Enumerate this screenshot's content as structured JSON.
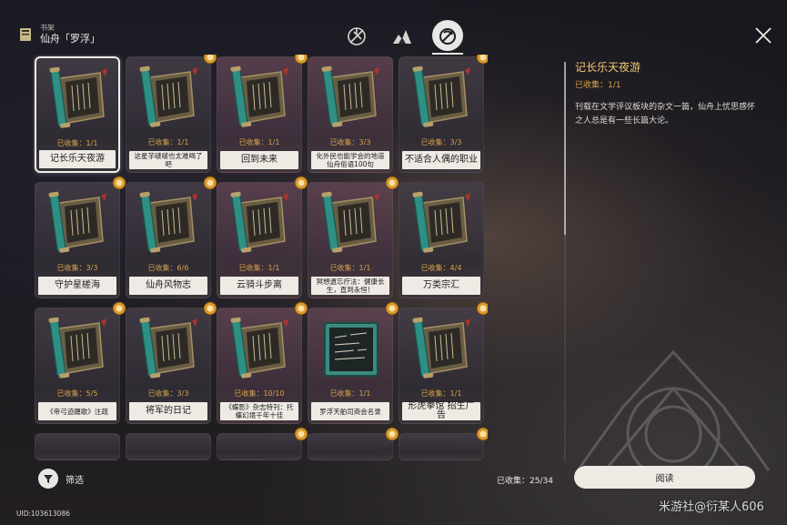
{
  "header": {
    "section_label": "书架",
    "title": "仙舟「罗浮」"
  },
  "category_tabs": [
    {
      "icon": "tree-emblem-icon",
      "active": false
    },
    {
      "icon": "peaks-emblem-icon",
      "active": false
    },
    {
      "icon": "luofu-emblem-icon",
      "active": true
    }
  ],
  "books": [
    {
      "title": "记长乐天夜游",
      "collected": "已收集：1/1",
      "art": "scroll",
      "badge": false,
      "selected": true,
      "small": false,
      "tone": "cool"
    },
    {
      "title": "这星芋啵啵也太难喝了吧",
      "collected": "已收集：1/1",
      "art": "scroll",
      "badge": true,
      "selected": false,
      "small": true,
      "tone": "cool"
    },
    {
      "title": "回到未来",
      "collected": "已收集：1/1",
      "art": "scroll",
      "badge": true,
      "selected": false,
      "small": false,
      "tone": "warm"
    },
    {
      "title": "化外民也能学会的地道仙舟俗语100句",
      "collected": "已收集：3/3",
      "art": "scroll",
      "badge": false,
      "selected": false,
      "small": true,
      "tone": "warm"
    },
    {
      "title": "不适合人偶的职业",
      "collected": "已收集：3/3",
      "art": "scroll",
      "badge": true,
      "selected": false,
      "small": false,
      "tone": "cool"
    },
    {
      "title": "守护星槎海",
      "collected": "已收集：3/3",
      "art": "scroll",
      "badge": true,
      "selected": false,
      "small": false,
      "tone": "cool"
    },
    {
      "title": "仙舟风物志",
      "collected": "已收集：6/6",
      "art": "scroll",
      "badge": true,
      "selected": false,
      "small": false,
      "tone": "cool"
    },
    {
      "title": "云骑斗步离",
      "collected": "已收集：1/1",
      "art": "scroll",
      "badge": true,
      "selected": false,
      "small": false,
      "tone": "warm"
    },
    {
      "title": "冥想遗忘疗法：健康长生，直到永恒！",
      "collected": "已收集：1/1",
      "art": "scroll",
      "badge": true,
      "selected": false,
      "small": true,
      "tone": "warm"
    },
    {
      "title": "万类宗汇",
      "collected": "已收集：4/4",
      "art": "scroll",
      "badge": false,
      "selected": false,
      "small": false,
      "tone": "cool"
    },
    {
      "title": "《帝弓迹躔歌》注疏",
      "collected": "已收集：5/5",
      "art": "scroll",
      "badge": true,
      "selected": false,
      "small": true,
      "tone": "cool"
    },
    {
      "title": "将军的日记",
      "collected": "已收集：3/3",
      "art": "scroll",
      "badge": true,
      "selected": false,
      "small": false,
      "tone": "cool"
    },
    {
      "title": "《蝶影》杂志特刊：托蝶幻境千年十佳",
      "collected": "已收集：10/10",
      "art": "scroll",
      "badge": true,
      "selected": false,
      "small": true,
      "tone": "warm"
    },
    {
      "title": "罗浮天舶司商会名录",
      "collected": "已收集：1/1",
      "art": "board",
      "badge": true,
      "selected": false,
      "small": true,
      "tone": "warm"
    },
    {
      "title": "形虎拳馆 招生广告",
      "collected": "已收集：1/1",
      "art": "scroll",
      "badge": true,
      "selected": false,
      "small": false,
      "tone": "cool"
    }
  ],
  "partial_row_badges": [
    false,
    false,
    true,
    true,
    true
  ],
  "detail": {
    "title": "记长乐天夜游",
    "collected": "已收集：1/1",
    "description": "刊载在文学评议板块的杂文一篇，仙舟上忧思感怀之人总是有一些长篇大论。"
  },
  "footer": {
    "filter_label": "筛选",
    "collected_total": "已收集：25/34",
    "read_button": "阅读",
    "uid": "UID:103613086"
  },
  "watermark": "米游社@衍某人606",
  "colors": {
    "accent_gold": "#d6a34b",
    "title_gold": "#f4c878",
    "card_label_bg": "#eeebe4"
  }
}
